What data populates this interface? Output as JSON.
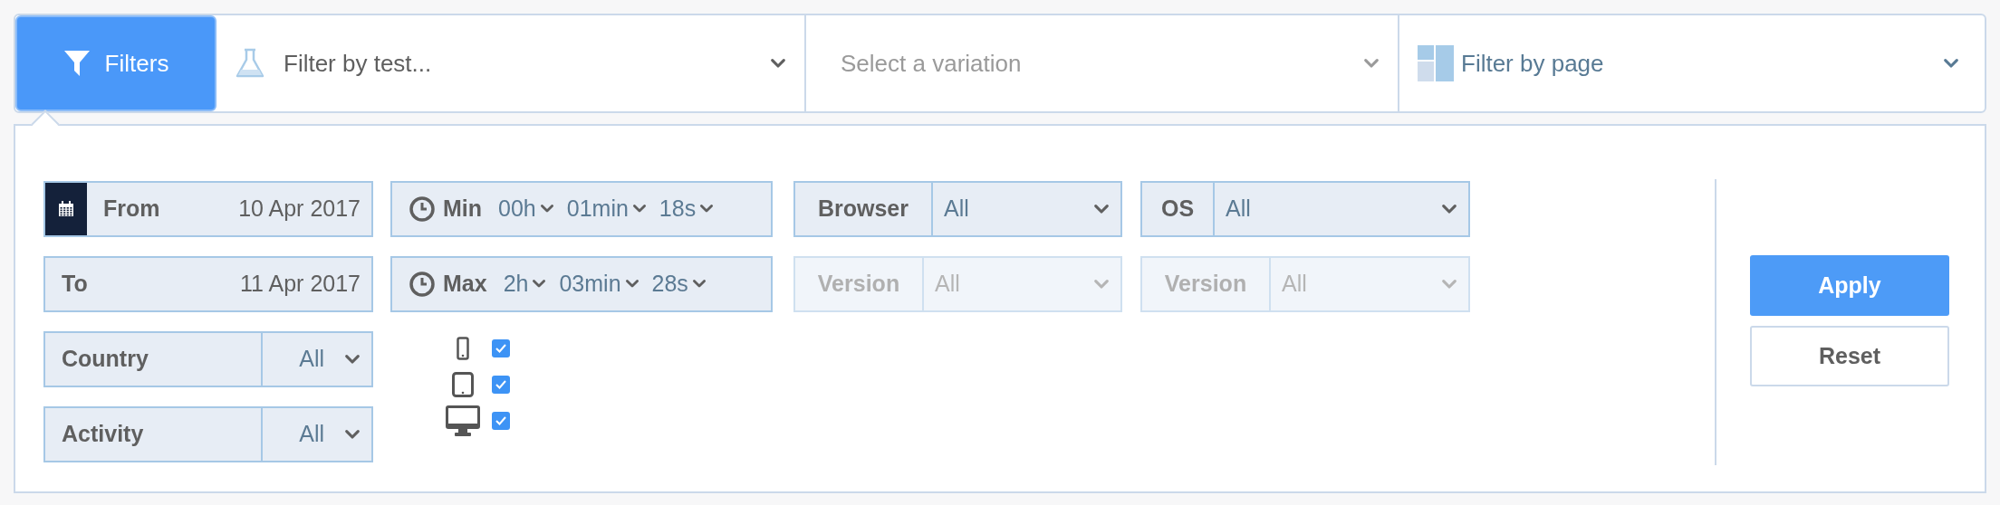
{
  "toolbar": {
    "filters_button": {
      "label": "Filters"
    },
    "test_filter": {
      "value": "Filter by test..."
    },
    "variation_filter": {
      "placeholder": "Select a variation"
    },
    "page_filter": {
      "value": "Filter by page"
    }
  },
  "panel": {
    "from": {
      "label": "From",
      "value": "10 Apr 2017"
    },
    "to": {
      "label": "To",
      "value": "11 Apr 2017"
    },
    "country": {
      "label": "Country",
      "value": "All"
    },
    "activity": {
      "label": "Activity",
      "value": "All"
    },
    "duration": [
      {
        "label": "Min",
        "hours": "00h",
        "minutes": "01min",
        "seconds": "18s"
      },
      {
        "label": "Max",
        "hours": "2h",
        "minutes": "03min",
        "seconds": "28s"
      }
    ],
    "devices": [
      {
        "kind": "phone",
        "checked": true
      },
      {
        "kind": "tablet",
        "checked": true
      },
      {
        "kind": "desktop",
        "checked": true
      }
    ],
    "browser": {
      "label": "Browser",
      "value": "All",
      "disabled": false
    },
    "browser_version": {
      "label": "Version",
      "value": "All",
      "disabled": true
    },
    "os": {
      "label": "OS",
      "value": "All",
      "disabled": false
    },
    "os_version": {
      "label": "Version",
      "value": "All",
      "disabled": true
    },
    "actions": [
      {
        "label": "Apply",
        "kind": "primary"
      },
      {
        "label": "Reset",
        "kind": "secondary"
      }
    ]
  }
}
